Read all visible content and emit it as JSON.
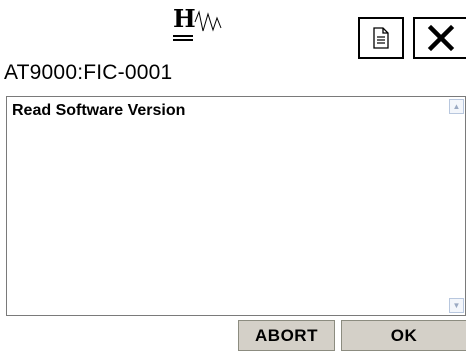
{
  "header": {
    "logo_letter": "H",
    "device_id": "AT9000:FIC-0001"
  },
  "icons": {
    "logo": "hw-logo-icon",
    "document": "document-icon",
    "close": "close-icon",
    "scroll_up": "scroll-up-arrow-icon",
    "scroll_down": "scroll-down-arrow-icon"
  },
  "content": {
    "message": "Read Software Version"
  },
  "buttons": {
    "abort_label": "ABORT",
    "ok_label": "OK"
  },
  "colors": {
    "background": "#ffffff",
    "button_face": "#d4d0c8",
    "scrollbar_button": "#f3f6fb"
  }
}
